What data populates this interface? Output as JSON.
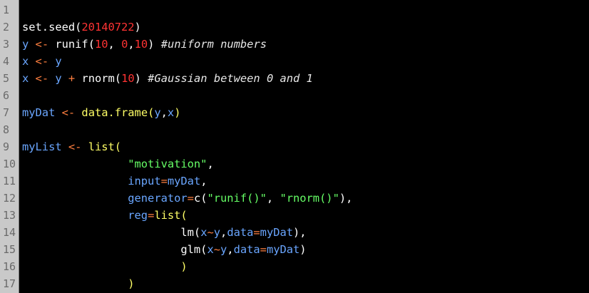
{
  "editor": {
    "lines": [
      {
        "number": "1",
        "tokens": []
      },
      {
        "number": "2",
        "tokens": [
          {
            "t": "set.seed(",
            "c": "plain"
          },
          {
            "t": "20140722",
            "c": "num"
          },
          {
            "t": ")",
            "c": "plain"
          }
        ]
      },
      {
        "number": "3",
        "tokens": [
          {
            "t": "y",
            "c": "var"
          },
          {
            "t": " <- ",
            "c": "op"
          },
          {
            "t": "runif(",
            "c": "plain"
          },
          {
            "t": "10",
            "c": "num"
          },
          {
            "t": ", ",
            "c": "plain"
          },
          {
            "t": "0",
            "c": "num"
          },
          {
            "t": ",",
            "c": "plain"
          },
          {
            "t": "10",
            "c": "num"
          },
          {
            "t": ") ",
            "c": "plain"
          },
          {
            "t": "#uniform numbers",
            "c": "comment"
          }
        ]
      },
      {
        "number": "4",
        "tokens": [
          {
            "t": "x",
            "c": "var"
          },
          {
            "t": " <- ",
            "c": "op"
          },
          {
            "t": "y",
            "c": "var"
          }
        ]
      },
      {
        "number": "5",
        "tokens": [
          {
            "t": "x",
            "c": "var"
          },
          {
            "t": " <- ",
            "c": "op"
          },
          {
            "t": "y",
            "c": "var"
          },
          {
            "t": " + ",
            "c": "op"
          },
          {
            "t": "rnorm(",
            "c": "plain"
          },
          {
            "t": "10",
            "c": "num"
          },
          {
            "t": ") ",
            "c": "plain"
          },
          {
            "t": "#Gaussian between 0 and 1",
            "c": "comment"
          }
        ]
      },
      {
        "number": "6",
        "tokens": []
      },
      {
        "number": "7",
        "tokens": [
          {
            "t": "myDat",
            "c": "var"
          },
          {
            "t": " <- ",
            "c": "op"
          },
          {
            "t": "data.frame(",
            "c": "func"
          },
          {
            "t": "y",
            "c": "var"
          },
          {
            "t": ",",
            "c": "plain"
          },
          {
            "t": "x",
            "c": "var"
          },
          {
            "t": ")",
            "c": "func"
          }
        ]
      },
      {
        "number": "8",
        "tokens": []
      },
      {
        "number": "9",
        "tokens": [
          {
            "t": "myList",
            "c": "var"
          },
          {
            "t": " <- ",
            "c": "op"
          },
          {
            "t": "list(",
            "c": "func"
          }
        ]
      },
      {
        "number": "10",
        "tokens": [
          {
            "t": "                \"motivation\"",
            "c": "str"
          },
          {
            "t": ",",
            "c": "plain"
          }
        ]
      },
      {
        "number": "11",
        "tokens": [
          {
            "t": "                input",
            "c": "var"
          },
          {
            "t": "=",
            "c": "op"
          },
          {
            "t": "myDat",
            "c": "var"
          },
          {
            "t": ",",
            "c": "plain"
          }
        ]
      },
      {
        "number": "12",
        "tokens": [
          {
            "t": "                generator",
            "c": "var"
          },
          {
            "t": "=",
            "c": "op"
          },
          {
            "t": "c(",
            "c": "plain"
          },
          {
            "t": "\"runif()\"",
            "c": "str"
          },
          {
            "t": ", ",
            "c": "plain"
          },
          {
            "t": "\"rnorm()\"",
            "c": "str"
          },
          {
            "t": "),",
            "c": "plain"
          }
        ]
      },
      {
        "number": "13",
        "tokens": [
          {
            "t": "                reg",
            "c": "var"
          },
          {
            "t": "=",
            "c": "op"
          },
          {
            "t": "list(",
            "c": "func"
          }
        ]
      },
      {
        "number": "14",
        "tokens": [
          {
            "t": "                        lm(",
            "c": "plain"
          },
          {
            "t": "x",
            "c": "var"
          },
          {
            "t": "~",
            "c": "op"
          },
          {
            "t": "y",
            "c": "var"
          },
          {
            "t": ",",
            "c": "plain"
          },
          {
            "t": "data",
            "c": "var"
          },
          {
            "t": "=",
            "c": "op"
          },
          {
            "t": "myDat",
            "c": "var"
          },
          {
            "t": "),",
            "c": "plain"
          }
        ]
      },
      {
        "number": "15",
        "tokens": [
          {
            "t": "                        glm(",
            "c": "plain"
          },
          {
            "t": "x",
            "c": "var"
          },
          {
            "t": "~",
            "c": "op"
          },
          {
            "t": "y",
            "c": "var"
          },
          {
            "t": ",",
            "c": "plain"
          },
          {
            "t": "data",
            "c": "var"
          },
          {
            "t": "=",
            "c": "op"
          },
          {
            "t": "myDat",
            "c": "var"
          },
          {
            "t": ")",
            "c": "plain"
          }
        ]
      },
      {
        "number": "16",
        "tokens": [
          {
            "t": "                        )",
            "c": "func"
          }
        ]
      },
      {
        "number": "17",
        "tokens": [
          {
            "t": "                )",
            "c": "func"
          }
        ]
      }
    ]
  }
}
